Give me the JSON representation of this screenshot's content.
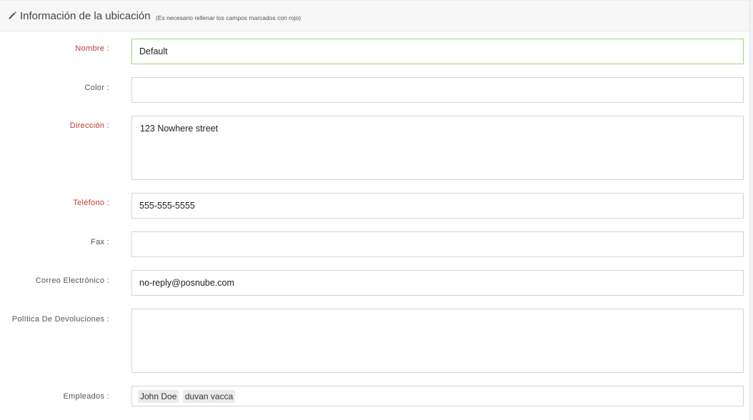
{
  "header": {
    "title": "Información de la ubicación",
    "note": "(Es necesario rellenar los campos marcados con rojo)",
    "icon": "pencil-icon"
  },
  "form": {
    "nombre": {
      "label": "Nombre :",
      "value": "Default",
      "required": true
    },
    "color": {
      "label": "Color :",
      "value": "",
      "required": false
    },
    "direccion": {
      "label": "Dirección :",
      "value": "123 Nowhere street",
      "required": true
    },
    "telefono": {
      "label": "Teléfono :",
      "value": "555-555-5555",
      "required": true
    },
    "fax": {
      "label": "Fax :",
      "value": "",
      "required": false
    },
    "correo": {
      "label": "Correo Electrónico :",
      "value": "no-reply@posnube.com",
      "required": false
    },
    "politica": {
      "label": "Política De Devoluciones :",
      "value": "",
      "required": false
    },
    "empleados": {
      "label": "Empleados :",
      "tags": [
        "John Doe",
        "duvan vacca"
      ],
      "required": false
    }
  },
  "colors": {
    "required_label": "#c0392b",
    "focus_border": "#a4d67c",
    "field_border": "#d5d5d5",
    "header_bg": "#f7f7f7"
  }
}
